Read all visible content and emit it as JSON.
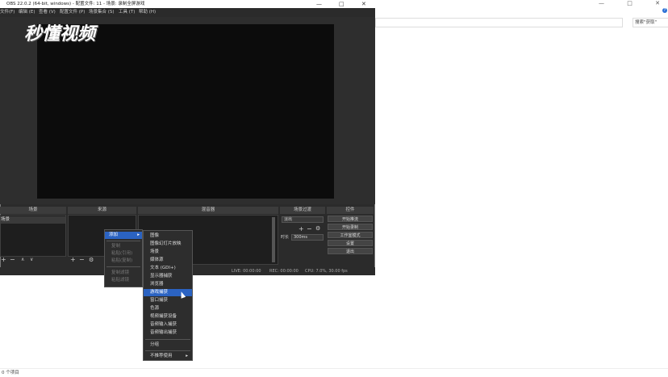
{
  "window": {
    "title": "OBS 22.0.2 (64-bit, windows) - 配置文件: 11 - 场景: 录制全屏游戏",
    "minimize": "—",
    "maximize": "□",
    "close": "✕"
  },
  "menubar": [
    "文件(F)",
    "编辑 (E)",
    "查看 (V)",
    "配置文件 (P)",
    "场景集合 (S)",
    "工具 (T)",
    "帮助 (H)"
  ],
  "watermark": "秒懂视频",
  "docks": {
    "scenes": {
      "title": "场景",
      "item": "场景"
    },
    "sources": {
      "title": "来源"
    },
    "mixer": {
      "title": "混音器"
    },
    "transitions": {
      "title": "场景过渡",
      "type": "淡出",
      "duration_label": "时长",
      "duration_value": "300ms"
    },
    "controls": {
      "title": "控件",
      "buttons": [
        "开始推流",
        "开始录制",
        "工作室模式",
        "设置",
        "退出"
      ]
    }
  },
  "toolbar_icons": {
    "add": "+",
    "remove": "−",
    "up": "∧",
    "down": "∨",
    "gear": "⚙"
  },
  "status": {
    "live": "LIVE: 00:00:00",
    "rec": "REC: 00:00:00",
    "cpu": "CPU: 7.0%, 30.00 fps"
  },
  "context_menu": {
    "items": [
      {
        "label": "添加",
        "arrow": "▸"
      },
      {
        "label": "复制"
      },
      {
        "label": "粘贴(引用)"
      },
      {
        "label": "粘贴(复制)"
      },
      {
        "label": "复制滤镜"
      },
      {
        "label": "粘贴滤镜"
      }
    ]
  },
  "add_submenu": {
    "items": [
      "图像",
      "图像幻灯片放映",
      "场景",
      "媒体源",
      "文本 (GDI+)",
      "显示器捕获",
      "浏览器",
      "游戏捕获",
      "窗口捕获",
      "色源",
      "视频捕获设备",
      "音频输入捕获",
      "音频输出捕获",
      "分组",
      "不推荐使用"
    ],
    "highlighted": "游戏捕获",
    "arrow": "▸"
  },
  "explorer": {
    "search_placeholder": "搜索\"获取\"",
    "status": "0 个项目",
    "help": "?",
    "controls": [
      "—",
      "□",
      "✕"
    ]
  },
  "colors": {
    "highlight": "#2b63c2",
    "obs_bg": "#2b2b2b",
    "preview": "#0c0c0c"
  }
}
